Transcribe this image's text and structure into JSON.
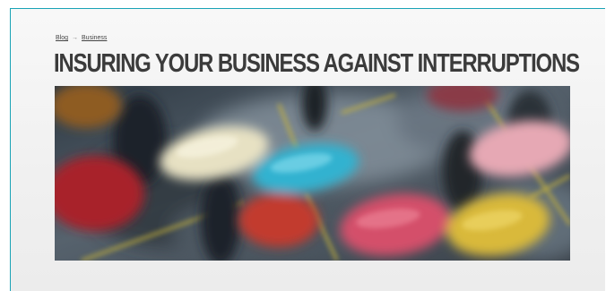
{
  "breadcrumb": {
    "items": [
      "Blog",
      "Business"
    ],
    "separator": "→"
  },
  "article": {
    "title": "INSURING YOUR BUSINESS AGAINST INTERRUPTIONS",
    "hero_image": "blurred umbrellas in the rain"
  },
  "colors": {
    "frame_border": "#1aa3b6",
    "title_text": "#3b3b3b"
  }
}
